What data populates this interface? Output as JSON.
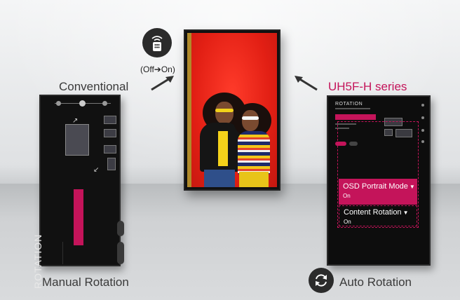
{
  "labels": {
    "conventional": "Conventional",
    "brand_series": "UH5F-H series",
    "off_on": "(Off➔On)",
    "manual_rotation": "Manual Rotation",
    "auto_rotation": "Auto Rotation"
  },
  "left_screen": {
    "menu_title": "ROTATION"
  },
  "right_screen": {
    "menu_title": "ROTATION",
    "osd_portrait_mode": {
      "label": "OSD Portrait Mode",
      "value": "On"
    },
    "content_rotation": {
      "label": "Content Rotation",
      "value": "On"
    }
  },
  "icons": {
    "remote": "remote-control-icon",
    "auto_rotate": "rotate-arrows-icon",
    "chevron": "chevron-down-icon"
  },
  "colors": {
    "brand": "#c4145a",
    "icon_bg": "#2b2b2b"
  }
}
